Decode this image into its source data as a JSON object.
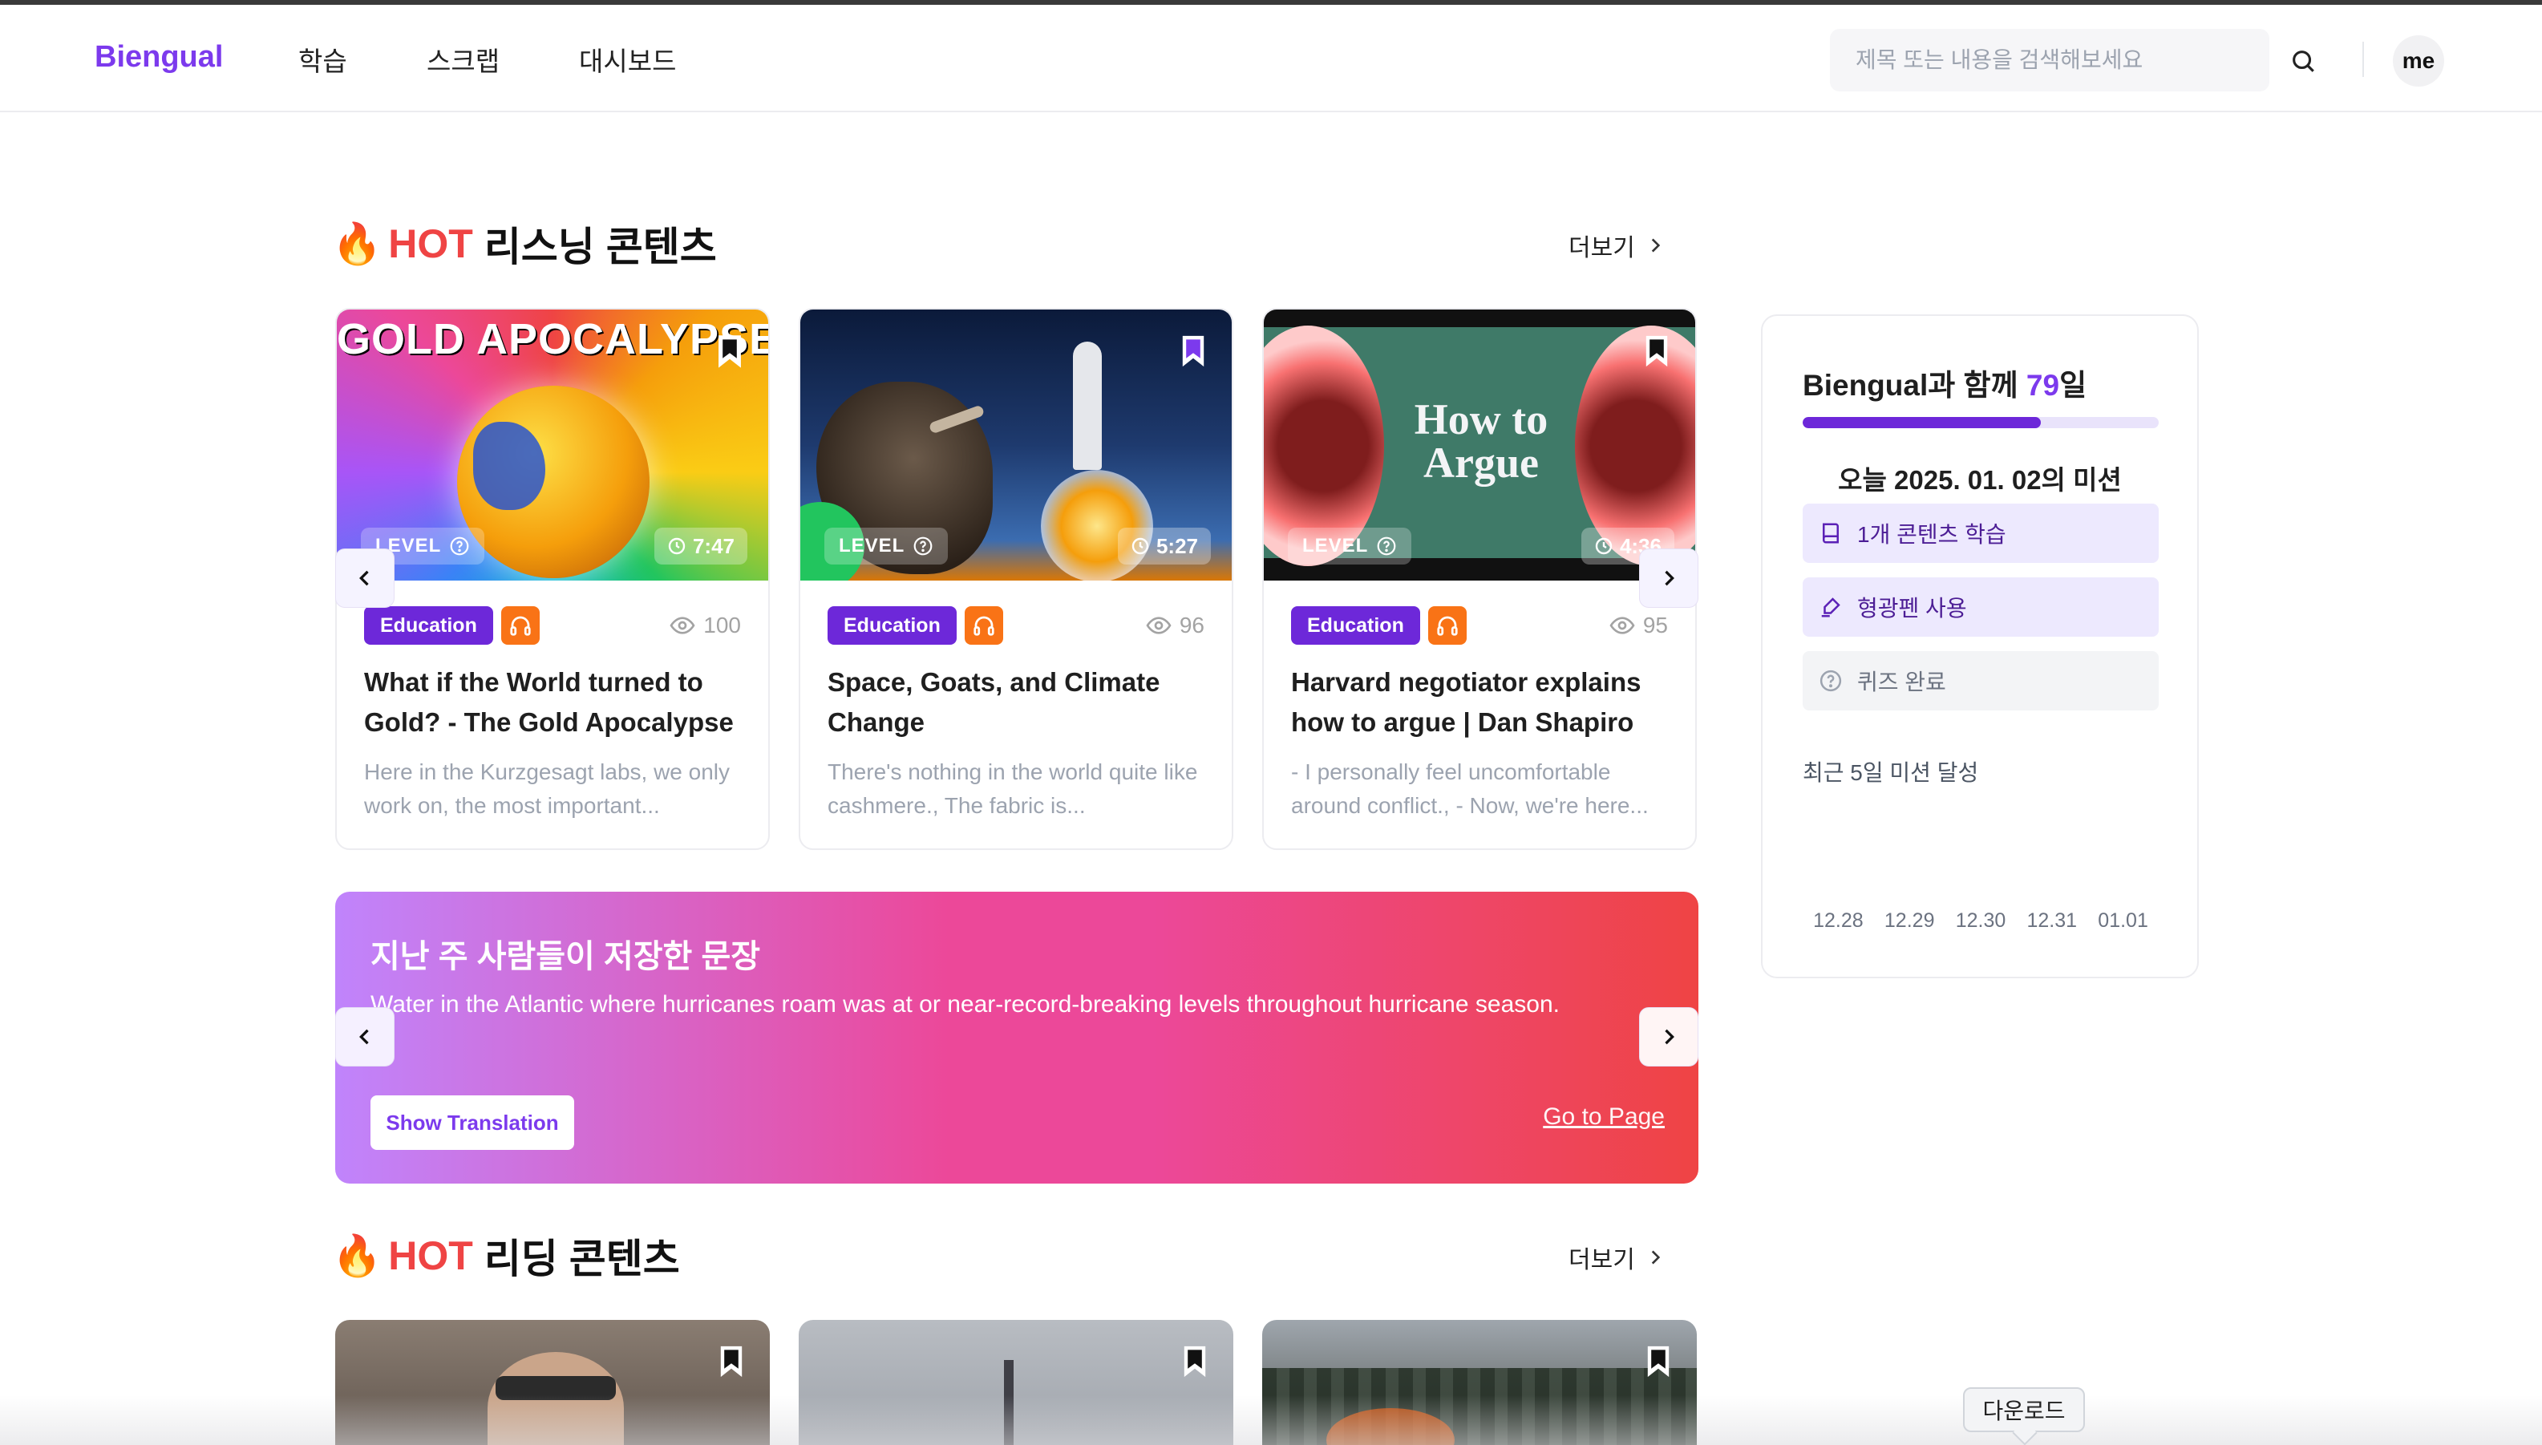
{
  "header": {
    "logo": "Biengual",
    "nav": [
      "학습",
      "스크랩",
      "대시보드"
    ],
    "search_placeholder": "제목 또는 내용을 검색해보세요",
    "avatar": "me"
  },
  "listening": {
    "title_emoji": "🔥",
    "title_hot": "HOT",
    "title_rest": "리스닝 콘텐츠",
    "more": "더보기",
    "cards": [
      {
        "thumb_text": "GOLD APOCALYPSE",
        "level": "LEVEL",
        "duration": "7:47",
        "category": "Education",
        "views": "100",
        "title": "What if the World turned to Gold? - The Gold Apocalypse",
        "desc": "Here in the Kurzgesagt labs, we only work on, the most important..."
      },
      {
        "thumb_text": "",
        "level": "LEVEL",
        "duration": "5:27",
        "category": "Education",
        "views": "96",
        "title": "Space, Goats, and Climate Change",
        "desc": "There's nothing in the world quite like cashmere., The fabric is..."
      },
      {
        "thumb_text": "How to Argue",
        "level": "LEVEL",
        "duration": "4:36",
        "category": "Education",
        "views": "95",
        "title": "Harvard negotiator explains how to argue | Dan Shapiro",
        "desc": "- I personally feel uncomfortable around conflict., - Now, we're here..."
      }
    ]
  },
  "banner": {
    "title": "지난 주 사람들이 저장한 문장",
    "sentence": "Water in the Atlantic where hurricanes roam was at or near-record-breaking levels throughout hurricane season.",
    "show_translation": "Show Translation",
    "go_to_page": "Go to Page"
  },
  "reading": {
    "title_emoji": "🔥",
    "title_hot": "HOT",
    "title_rest": "리딩 콘텐츠",
    "more": "더보기"
  },
  "panel": {
    "title_prefix": "Biengual과 함께 ",
    "days_count": "79",
    "title_suffix": "일",
    "progress_fraction": 0.67,
    "mission_date": "오늘 2025. 01. 02의 미션",
    "missions": [
      {
        "label": "1개 콘텐츠 학습",
        "icon": "book-icon",
        "done": true
      },
      {
        "label": "형광펜 사용",
        "icon": "highlighter-icon",
        "done": true
      },
      {
        "label": "퀴즈 완료",
        "icon": "question-circle-icon",
        "done": false
      }
    ],
    "recent_label": "최근 5일 미션 달성",
    "days": [
      "12.28",
      "12.29",
      "12.30",
      "12.31",
      "01.01"
    ]
  },
  "tooltip": "다운로드",
  "colors": {
    "brand": "#7c3aed",
    "hot": "#ef4444",
    "category": "#6d28d9",
    "audio": "#f97316"
  }
}
